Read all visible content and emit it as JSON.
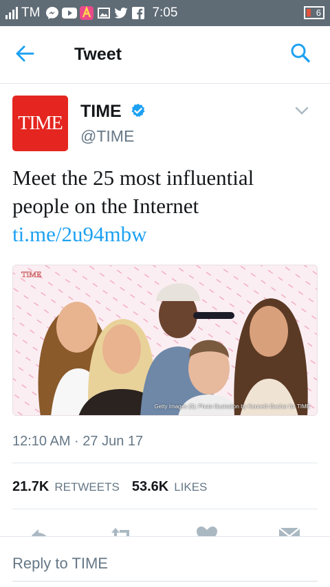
{
  "status_bar": {
    "carrier": "TM",
    "time": "7:05",
    "battery": "6",
    "icons": [
      "signal-icon",
      "messenger-icon",
      "youtube-icon",
      "app-icon",
      "gallery-icon",
      "twitter-icon",
      "facebook-icon"
    ]
  },
  "header": {
    "title": "Tweet",
    "back_icon": "arrow-left-icon",
    "search_icon": "search-icon"
  },
  "tweet": {
    "avatar_text": "TIME",
    "author_name": "TIME",
    "author_handle": "@TIME",
    "text_prefix": "Meet the 25 most influential people on the Internet ",
    "link_text": "ti.me/2u94mbw",
    "media": {
      "brand": "TIME",
      "credit": "Getty Images (5); Photo Illustration by Kenneth Bachor for TIME"
    },
    "timestamp": "12:10 AM · 27 Jun 17",
    "retweets_count": "21.7K",
    "retweets_label": "RETWEETS",
    "likes_count": "53.6K",
    "likes_label": "LIKES"
  },
  "actions": [
    "reply-icon",
    "retweet-icon",
    "like-icon",
    "message-icon"
  ],
  "reply": {
    "placeholder": "Reply to TIME"
  },
  "colors": {
    "accent": "#1da1f2",
    "time_red": "#e5251f",
    "status_bar": "#5f6b75",
    "muted": "#657786"
  }
}
